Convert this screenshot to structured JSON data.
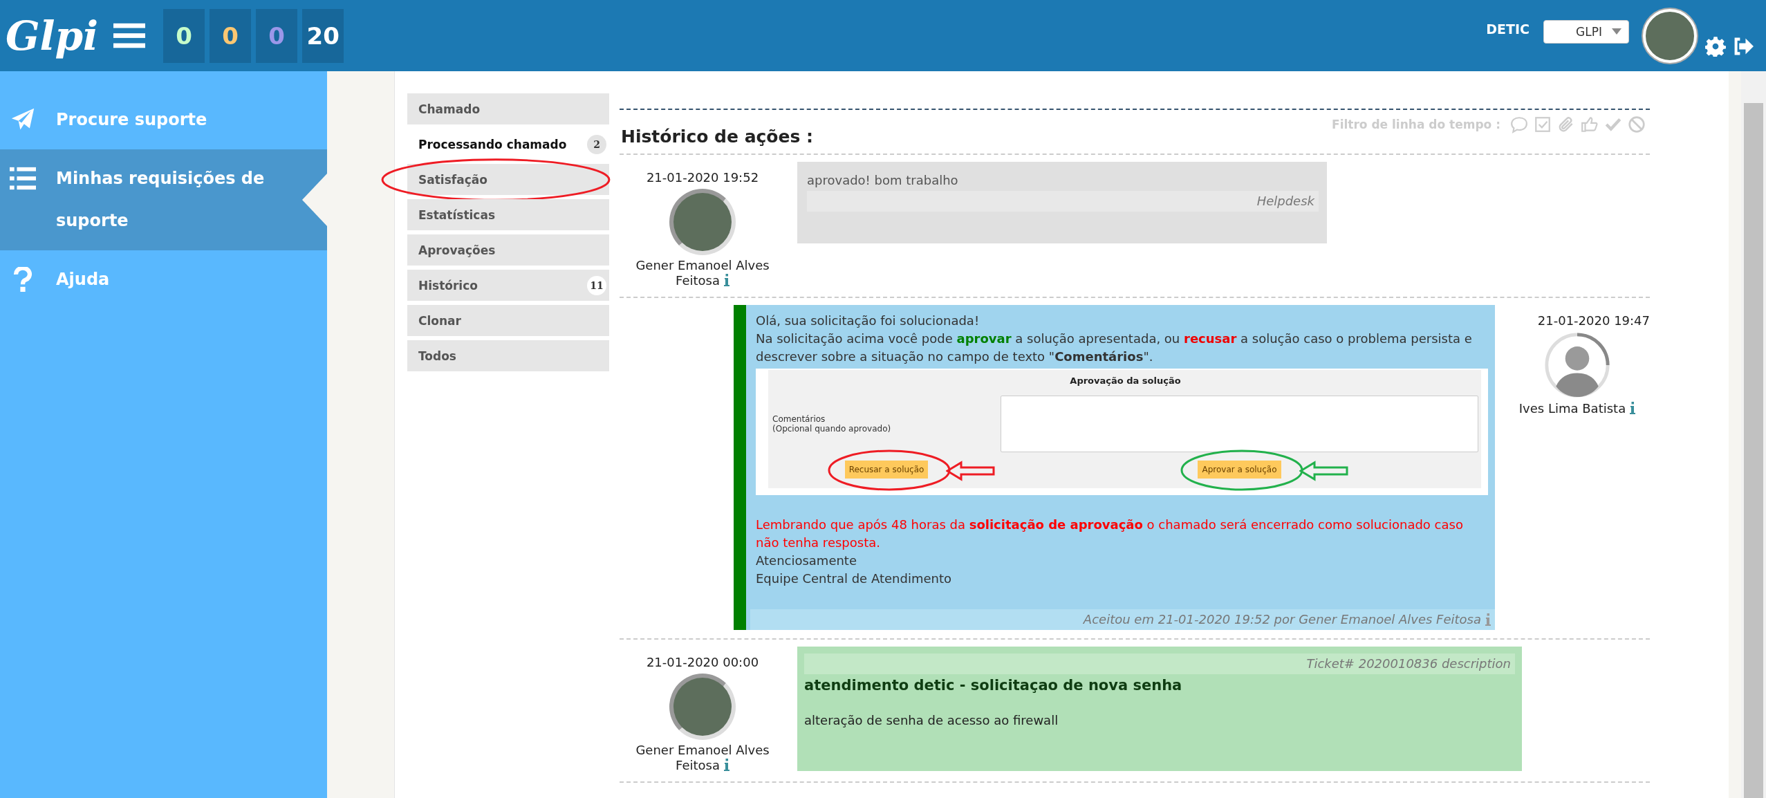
{
  "header": {
    "logo": "Glpi",
    "counters": [
      {
        "value": "0",
        "color": "#c6fcca"
      },
      {
        "value": "0",
        "color": "#fbc772"
      },
      {
        "value": "0",
        "color": "#9b97e9"
      },
      {
        "value": "20",
        "color": "#ffffff"
      }
    ],
    "entity": "DETIC",
    "profile_select": "GLPI"
  },
  "sidebar": {
    "items": [
      {
        "label": "Procure suporte",
        "kind": "plane",
        "selected": false
      },
      {
        "label": "Minhas requisições de suporte",
        "kind": "list",
        "selected": true
      },
      {
        "label": "Ajuda",
        "kind": "help",
        "selected": false
      }
    ]
  },
  "tabs": [
    {
      "label": "Chamado",
      "selected": false,
      "circled": false
    },
    {
      "label": "Processando chamado",
      "selected": true,
      "circled": false,
      "badge": "2"
    },
    {
      "label": "Satisfação",
      "selected": false,
      "circled": true
    },
    {
      "label": "Estatísticas",
      "selected": false,
      "circled": false
    },
    {
      "label": "Aprovações",
      "selected": false,
      "circled": false
    },
    {
      "label": "Histórico",
      "selected": false,
      "circled": false,
      "badge": "11"
    },
    {
      "label": "Clonar",
      "selected": false,
      "circled": false
    },
    {
      "label": "Todos",
      "selected": false,
      "circled": false
    }
  ],
  "timeline": {
    "title": "Histórico de ações :",
    "filter_label": "Filtro de linha do tempo :",
    "entries": [
      {
        "kind": "followup",
        "date": "21-01-2020 19:52",
        "author": "Gener Emanoel Alves Feitosa",
        "avatar_photo": true,
        "text": "aprovado! bom trabalho",
        "source": "Helpdesk"
      },
      {
        "kind": "solution",
        "date": "21-01-2020 19:47",
        "author": "Ives Lima Batista",
        "avatar_photo": false,
        "greeting": "Olá, sua solicitação foi solucionada!",
        "instruction": [
          {
            "text": "Na solicitação acima você pode ",
            "kind": "plain"
          },
          {
            "text": "aprovar",
            "kind": "approve"
          },
          {
            "text": " a solução apresentada, ou ",
            "kind": "plain"
          },
          {
            "text": "recusar",
            "kind": "refuse"
          },
          {
            "text": " a solução caso o problema persista e descrever sobre a situação no campo de texto \"",
            "kind": "plain"
          },
          {
            "text": "Comentários",
            "kind": "strong"
          },
          {
            "text": "\".",
            "kind": "plain"
          }
        ],
        "form": {
          "title": "Aprovação da solução",
          "field_label": "Comentários",
          "field_hint": "(Opcional quando aprovado)",
          "buttons": [
            {
              "label": "Recusar a solução",
              "color": "#ee1c24"
            },
            {
              "label": "Aprovar a solução",
              "color": "#22b14c"
            }
          ]
        },
        "reminder": "Lembrando que após 48 horas da **solicitação de aprovação** o chamado será encerrado como solucionado caso não tenha resposta.",
        "closing": [
          "Atenciosamente",
          "Equipe Central de Atendimento"
        ],
        "footer": "Aceitou em 21-01-2020 19:52 por Gener Emanoel Alves Feitosa"
      },
      {
        "kind": "description",
        "date": "21-01-2020 00:00",
        "author": "Gener Emanoel Alves Feitosa",
        "avatar_photo": true,
        "header": "Ticket# 2020010836 description",
        "title": "atendimento detic - solicitaçao de nova senha",
        "text": "alteração de senha de acesso ao firewall"
      }
    ]
  }
}
